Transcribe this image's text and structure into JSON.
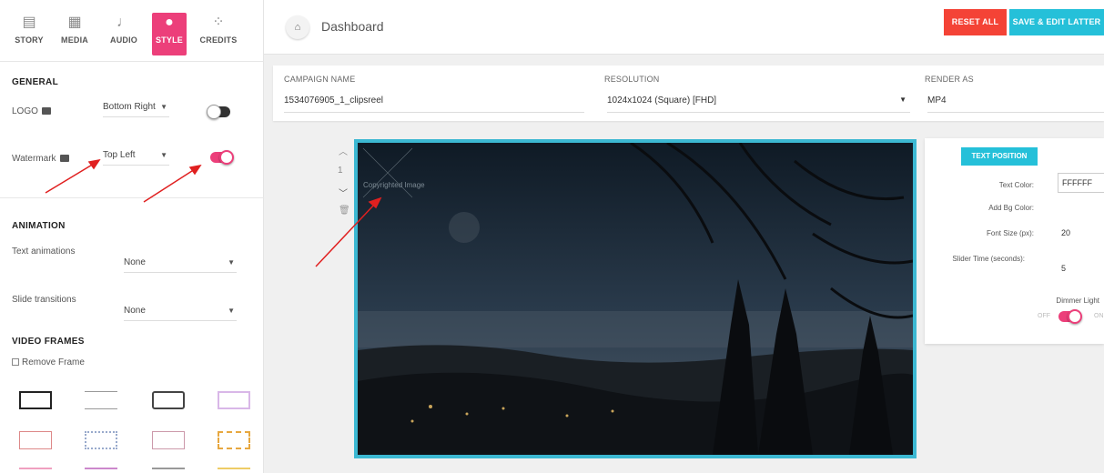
{
  "sidebar": {
    "tabs": [
      {
        "label": "STORY",
        "icon": "clipboard-icon"
      },
      {
        "label": "MEDIA",
        "icon": "image-icon"
      },
      {
        "label": "AUDIO",
        "icon": "music-note-icon"
      },
      {
        "label": "STYLE",
        "icon": "palette-icon"
      },
      {
        "label": "CREDITS",
        "icon": "people-icon"
      }
    ],
    "active_tab": "STYLE",
    "general_title": "GENERAL",
    "logo_label": "LOGO",
    "logo_position": "Bottom Right",
    "logo_enabled": false,
    "watermark_label": "Watermark",
    "watermark_position": "Top Left",
    "watermark_enabled": true,
    "animation_title": "ANIMATION",
    "text_animations_label": "Text animations",
    "text_animations_value": "None",
    "slide_transitions_label": "Slide transitions",
    "slide_transitions_value": "None",
    "video_frames_title": "VIDEO FRAMES",
    "remove_frame_label": "Remove Frame"
  },
  "header": {
    "title": "Dashboard",
    "reset_label": "RESET ALL",
    "save_label": "SAVE & EDIT LATTER"
  },
  "settings": {
    "campaign_name_label": "CAMPAIGN NAME",
    "campaign_name_value": "1534076905_1_clipsreel",
    "resolution_label": "RESOLUTION",
    "resolution_value": "1024x1024 (Square) [FHD]",
    "render_as_label": "RENDER AS",
    "render_as_value": "MP4"
  },
  "slide": {
    "number": "1",
    "watermark_text": "Copyrighted Image"
  },
  "text_panel": {
    "button_label": "TEXT POSITION",
    "text_color_label": "Text Color:",
    "text_color_value": "FFFFFF",
    "bg_color_label": "Add Bg Color:",
    "font_size_label": "Font Size (px):",
    "font_size_value": "20",
    "slider_time_label": "Slider Time (seconds):",
    "slider_time_value": "5",
    "dimmer_label": "Dimmer Light",
    "dimmer_off": "OFF",
    "dimmer_on": "ON",
    "dimmer_enabled": true
  },
  "colors": {
    "accent_pink": "#ec3f7a",
    "reset_red": "#f44336",
    "save_cyan": "#25c0d9",
    "preview_border": "#3cb8d2",
    "annotation_arrow": "#e02020"
  }
}
